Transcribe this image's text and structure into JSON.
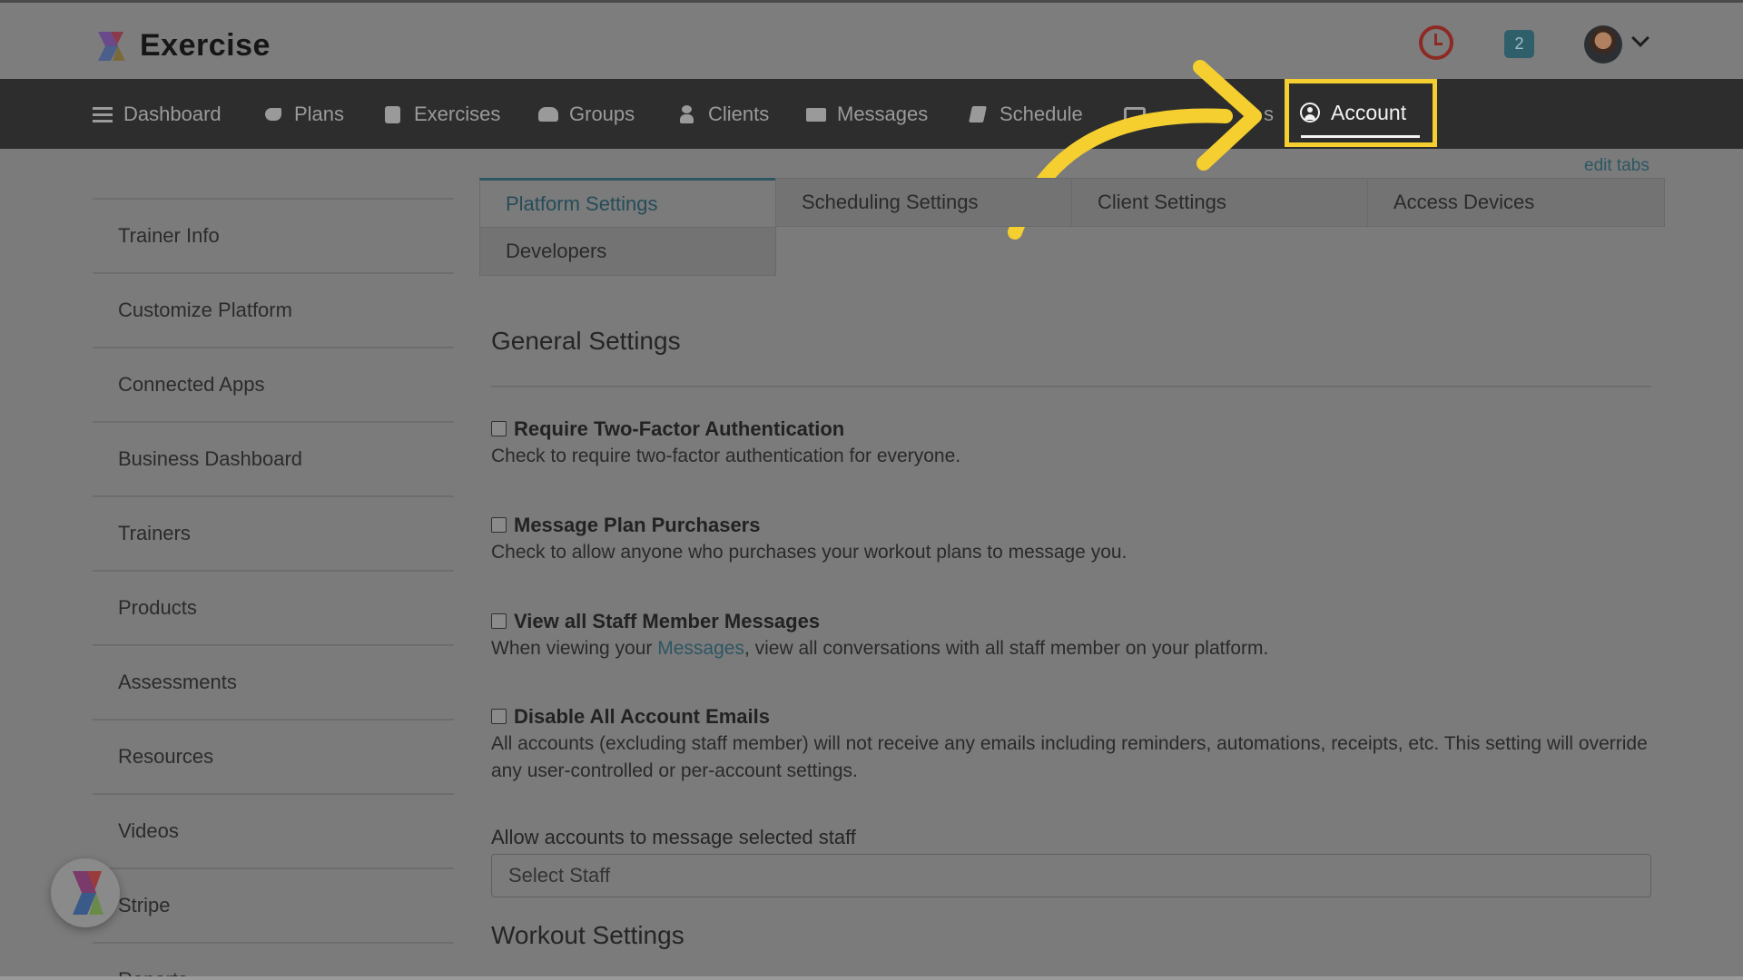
{
  "app": {
    "name": "Exercise"
  },
  "header": {
    "notification_count": "2"
  },
  "nav": {
    "items": [
      {
        "label": "Dashboard",
        "icon": "list-icon"
      },
      {
        "label": "Plans",
        "icon": "bird-icon"
      },
      {
        "label": "Exercises",
        "icon": "book-icon"
      },
      {
        "label": "Groups",
        "icon": "group-icon"
      },
      {
        "label": "Clients",
        "icon": "user-icon"
      },
      {
        "label": "Messages",
        "icon": "envelope-icon"
      },
      {
        "label": "Schedule",
        "icon": "calendar-icon"
      },
      {
        "label": "s",
        "icon": "partial-icon"
      }
    ],
    "active": {
      "label": "Account",
      "icon": "user-circle-icon"
    },
    "edit_tabs": "edit tabs"
  },
  "sidebar": {
    "items": [
      {
        "label": "Trainer Info"
      },
      {
        "label": "Customize Platform"
      },
      {
        "label": "Connected Apps"
      },
      {
        "label": "Business Dashboard"
      },
      {
        "label": "Trainers"
      },
      {
        "label": "Products"
      },
      {
        "label": "Assessments"
      },
      {
        "label": "Resources"
      },
      {
        "label": "Videos"
      },
      {
        "label": "Stripe"
      },
      {
        "label": "Reports"
      }
    ]
  },
  "tabs": {
    "items": [
      {
        "label": "Platform Settings"
      },
      {
        "label": "Scheduling Settings"
      },
      {
        "label": "Client Settings"
      },
      {
        "label": "Access Devices"
      },
      {
        "label": "Developers"
      }
    ]
  },
  "general": {
    "title": "General Settings",
    "settings": [
      {
        "label": "Require Two-Factor Authentication",
        "desc": "Check to require two-factor authentication for everyone.",
        "checked": false
      },
      {
        "label": "Message Plan Purchasers",
        "desc": "Check to allow anyone who purchases your workout plans to message you.",
        "checked": false
      },
      {
        "label": "View all Staff Member Messages",
        "desc_before": "When viewing your ",
        "desc_link": "Messages",
        "desc_after": ", view all conversations with all staff member on your platform.",
        "checked": false
      },
      {
        "label": "Disable All Account Emails",
        "desc": "All accounts (excluding staff member) will not receive any emails including reminders, automations, receipts, etc. This setting will override any user-controlled or per-account settings.",
        "checked": false
      }
    ],
    "staff_label": "Allow accounts to message selected staff",
    "staff_placeholder": "Select Staff"
  },
  "workout": {
    "title": "Workout Settings"
  },
  "colors": {
    "highlight": "#f5cf2f",
    "accent": "#2d5663",
    "navbar": "#2d2d2d"
  }
}
